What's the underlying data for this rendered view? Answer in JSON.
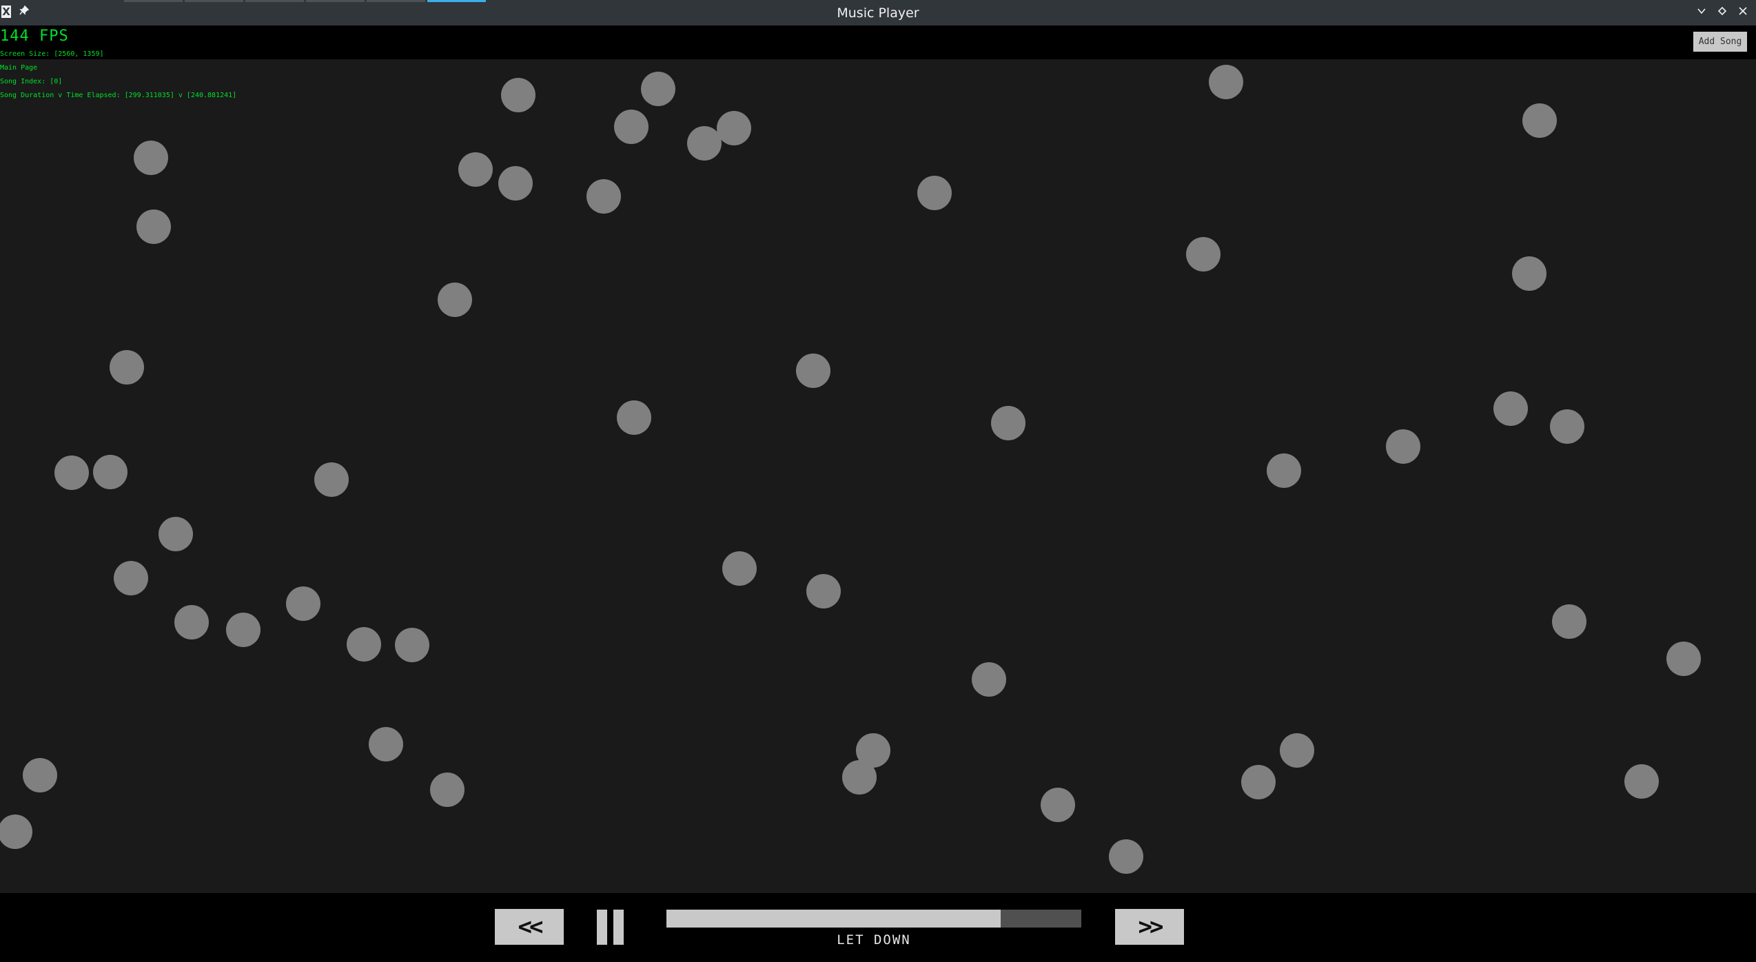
{
  "window": {
    "title": "Music Player",
    "app_icon": "X",
    "icons": {
      "pin": "pin-icon",
      "minimize": "chevron-down-icon",
      "maximize": "diamond-icon",
      "close": "close-icon"
    }
  },
  "header": {
    "add_song_label": "Add Song"
  },
  "debug": {
    "fps": "144 FPS",
    "screen_size": "Screen Size: [2560, 1359]",
    "page": "Main Page",
    "song_index": "Song Index: [0]",
    "duration_elapsed": "Song Duration v Time Elapsed: [299.311035] v [240.881241]"
  },
  "player": {
    "prev_label": "<<",
    "next_label": ">>",
    "song_title": "LET DOWN",
    "progress_fraction": 0.805,
    "is_playing": true
  },
  "colors": {
    "background": "#1a1a1a",
    "debug_text": "#00e02a",
    "ball": "#808080",
    "control": "#c8c8c8"
  }
}
